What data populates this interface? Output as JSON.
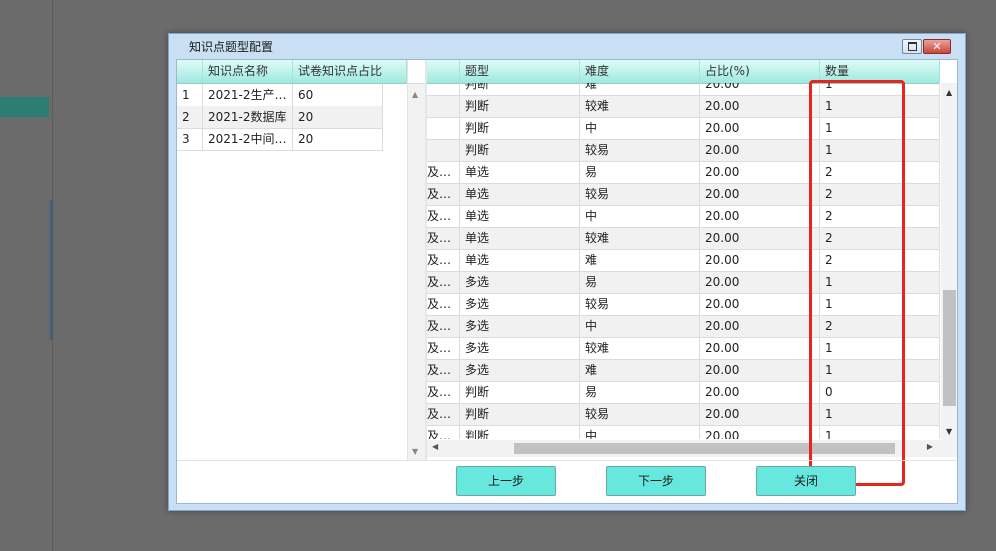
{
  "dialog": {
    "title": "知识点题型配置",
    "close_glyph": "✕"
  },
  "left_table": {
    "headers": [
      "",
      "知识点名称",
      "试卷知识点占比"
    ],
    "rows": [
      [
        "1",
        "2021-2生产…",
        "60"
      ],
      [
        "2",
        "2021-2数据库",
        "20"
      ],
      [
        "3",
        "2021-2中间…",
        "20"
      ]
    ]
  },
  "right_table": {
    "headers": [
      "",
      "题型",
      "难度",
      "占比(%)",
      "数量"
    ],
    "rows": [
      [
        "",
        "判断",
        "难",
        "20.00",
        "1"
      ],
      [
        "",
        "判断",
        "较难",
        "20.00",
        "1"
      ],
      [
        "",
        "判断",
        "中",
        "20.00",
        "1"
      ],
      [
        "",
        "判断",
        "较易",
        "20.00",
        "1"
      ],
      [
        "及…",
        "单选",
        "易",
        "20.00",
        "2"
      ],
      [
        "及…",
        "单选",
        "较易",
        "20.00",
        "2"
      ],
      [
        "及…",
        "单选",
        "中",
        "20.00",
        "2"
      ],
      [
        "及…",
        "单选",
        "较难",
        "20.00",
        "2"
      ],
      [
        "及…",
        "单选",
        "难",
        "20.00",
        "2"
      ],
      [
        "及…",
        "多选",
        "易",
        "20.00",
        "1"
      ],
      [
        "及…",
        "多选",
        "较易",
        "20.00",
        "1"
      ],
      [
        "及…",
        "多选",
        "中",
        "20.00",
        "2"
      ],
      [
        "及…",
        "多选",
        "较难",
        "20.00",
        "1"
      ],
      [
        "及…",
        "多选",
        "难",
        "20.00",
        "1"
      ],
      [
        "及…",
        "判断",
        "易",
        "20.00",
        "0"
      ],
      [
        "及…",
        "判断",
        "较易",
        "20.00",
        "1"
      ],
      [
        "及…",
        "判断",
        "中",
        "20.00",
        "1"
      ]
    ]
  },
  "buttons": {
    "prev": "上一步",
    "next": "下一步",
    "close": "关闭"
  },
  "colors": {
    "header_teal": "#9ee9df",
    "button_teal": "#66e8de",
    "highlight_red": "#e8241f"
  }
}
